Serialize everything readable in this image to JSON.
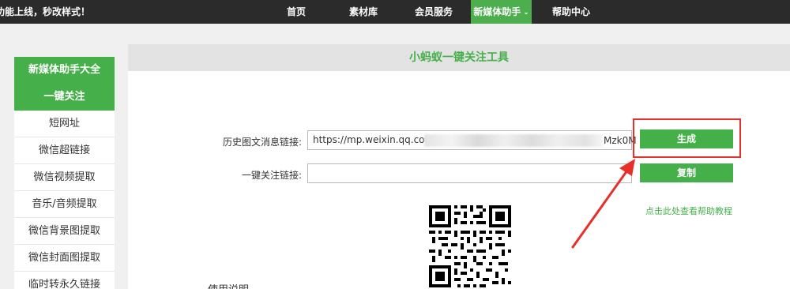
{
  "topbar": {
    "promo": "功能上线，秒改样式！",
    "nav": [
      {
        "label": "首页"
      },
      {
        "label": "素材库"
      },
      {
        "label": "会员服务"
      },
      {
        "label": "新媒体助手",
        "active": true,
        "caret": "⌄"
      },
      {
        "label": "帮助中心"
      }
    ]
  },
  "sidebar": {
    "title": "新媒体助手大全",
    "items": [
      {
        "label": "一键关注",
        "active": true
      },
      {
        "label": "短网址"
      },
      {
        "label": "微信超链接"
      },
      {
        "label": "微信视频提取"
      },
      {
        "label": "音乐/音频提取"
      },
      {
        "label": "微信背景图提取"
      },
      {
        "label": "微信封面图提取"
      },
      {
        "label": "临时转永久链接"
      }
    ]
  },
  "main": {
    "title": "小蚂蚁一键关注工具",
    "history_label": "历史图文消息链接:",
    "history_value_start": "https://mp.weixin.qq.com/mp",
    "history_value_end": "Mzk0M",
    "follow_label": "一键关注链接:",
    "follow_value": "",
    "generate_button": "生成",
    "copy_button": "复制",
    "help_link": "点击此处查看帮助教程",
    "partial_section_title": "使用说明"
  },
  "colors": {
    "accent": "#45b04a",
    "nav_bg": "#2b2b2b",
    "highlight": "#e8302b"
  }
}
